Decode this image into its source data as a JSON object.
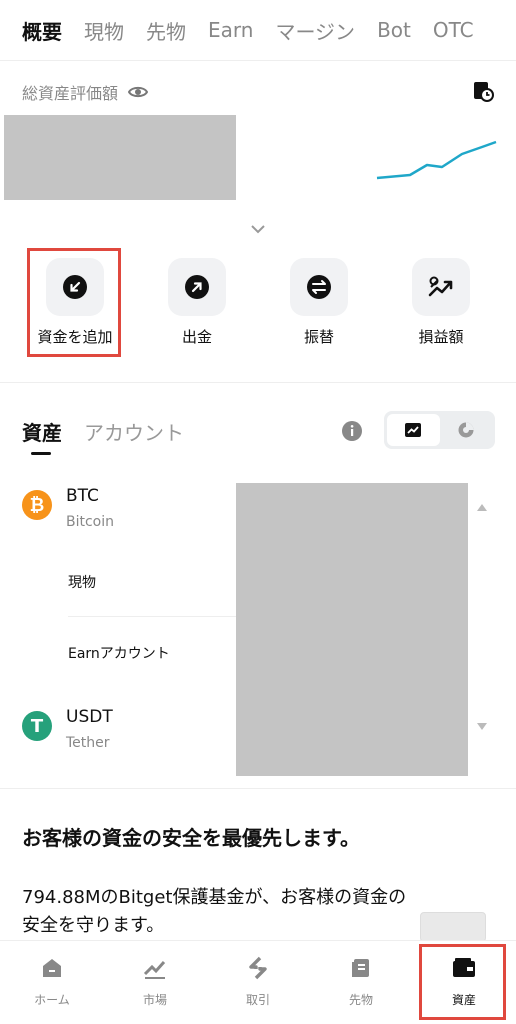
{
  "top_tabs": [
    {
      "label": "概要",
      "active": true
    },
    {
      "label": "現物",
      "active": false
    },
    {
      "label": "先物",
      "active": false
    },
    {
      "label": "Earn",
      "active": false
    },
    {
      "label": "マージン",
      "active": false
    },
    {
      "label": "Bot",
      "active": false
    },
    {
      "label": "OTC",
      "active": false
    }
  ],
  "assets_header": {
    "title": "総資産評価額",
    "visibility_icon": "eye-icon",
    "history_icon": "history-icon"
  },
  "actions": [
    {
      "label": "資金を追加",
      "icon": "arrow-down-left-icon",
      "highlighted": true
    },
    {
      "label": "出金",
      "icon": "arrow-up-right-icon",
      "highlighted": false
    },
    {
      "label": "振替",
      "icon": "transfer-icon",
      "highlighted": false
    },
    {
      "label": "損益額",
      "icon": "pnl-icon",
      "highlighted": false
    }
  ],
  "asset_tabs": [
    {
      "label": "資産",
      "active": true
    },
    {
      "label": "アカウント",
      "active": false
    }
  ],
  "view_toggle": {
    "options": [
      "line-chart-icon",
      "pie-chart-icon"
    ],
    "selected": "line-chart-icon"
  },
  "coins": [
    {
      "symbol": "BTC",
      "name": "Bitcoin",
      "icon_glyph": "₿",
      "color": "#f7931a",
      "expanded": true,
      "sub_items": [
        "現物",
        "Earnアカウント"
      ]
    },
    {
      "symbol": "USDT",
      "name": "Tether",
      "icon_glyph": "T",
      "color": "#26a17b",
      "expanded": false
    }
  ],
  "promo": {
    "title": "お客様の資金の安全を最優先します。",
    "body": "794.88MのBitget保護基金が、お客様の資金の安全を守ります。"
  },
  "bottom_nav": [
    {
      "label": "ホーム",
      "icon": "home-icon",
      "active": false
    },
    {
      "label": "市場",
      "icon": "market-icon",
      "active": false
    },
    {
      "label": "取引",
      "icon": "trade-icon",
      "active": false
    },
    {
      "label": "先物",
      "icon": "futures-icon",
      "active": false
    },
    {
      "label": "資産",
      "icon": "wallet-icon",
      "active": true,
      "highlighted": true
    }
  ],
  "colors": {
    "accent_highlight": "#e0483e",
    "sparkline": "#1fa7c9",
    "tile_bg": "#f1f2f4"
  }
}
